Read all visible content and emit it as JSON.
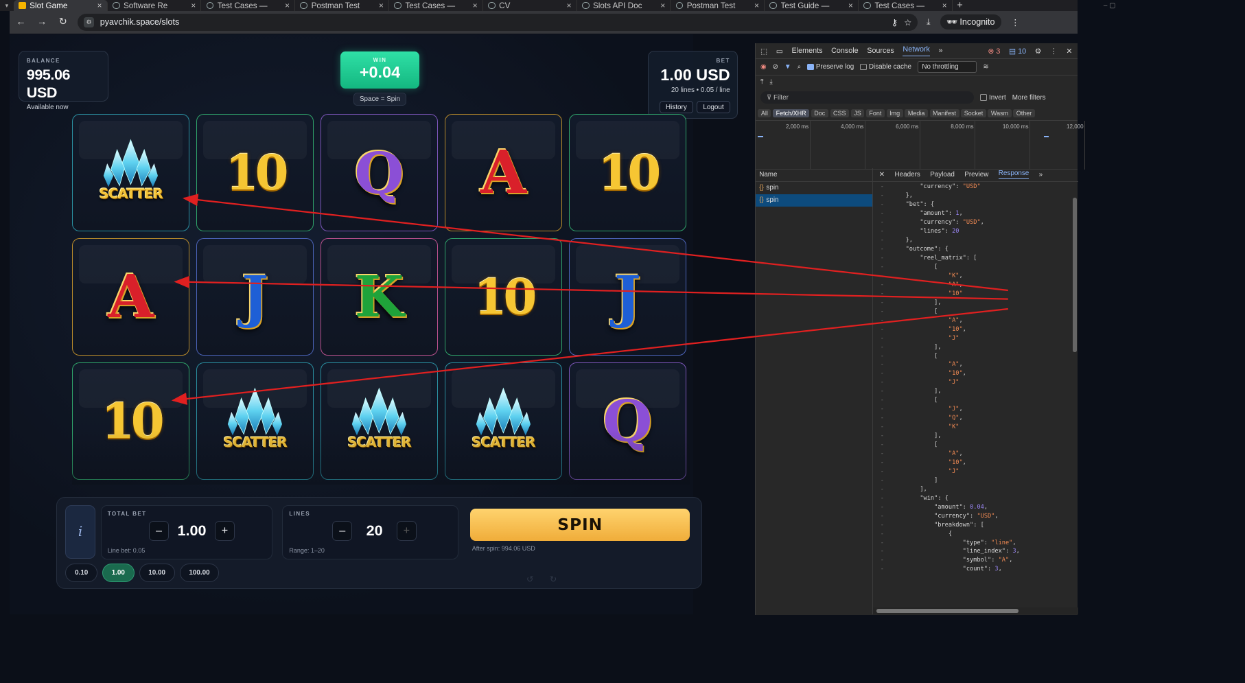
{
  "browser": {
    "tabs": [
      {
        "title": "Slot Game",
        "active": true
      },
      {
        "title": "Software Re"
      },
      {
        "title": "Test Cases —"
      },
      {
        "title": "Postman Test"
      },
      {
        "title": "Test Cases —"
      },
      {
        "title": "CV"
      },
      {
        "title": "Slots API Doc"
      },
      {
        "title": "Postman Test"
      },
      {
        "title": "Test Guide —"
      },
      {
        "title": "Test Cases —"
      }
    ],
    "url": "pyavchik.space/slots",
    "incognito_label": "Incognito"
  },
  "game": {
    "balance": {
      "label": "BALANCE",
      "amount": "995.06 USD",
      "sub": "Available now"
    },
    "win": {
      "label": "WIN",
      "amount": "+0.04"
    },
    "hint": "Space = Spin",
    "bet": {
      "label": "BET",
      "amount": "1.00 USD",
      "sub": "20 lines • 0.05 / line",
      "history": "History",
      "logout": "Logout"
    },
    "reels": [
      [
        "scatter",
        "A",
        "10"
      ],
      [
        "10",
        "J",
        "scatter"
      ],
      [
        "Q",
        "K",
        "scatter"
      ],
      [
        "A",
        "10",
        "scatter"
      ],
      [
        "10",
        "J",
        "Q"
      ]
    ],
    "scatter_text": "SCATTER",
    "controls": {
      "info": "i",
      "total_bet_label": "TOTAL BET",
      "total_bet": "1.00",
      "line_bet": "Line bet: 0.05",
      "lines_label": "LINES",
      "lines": "20",
      "range": "Range: 1–20",
      "spin": "SPIN",
      "after_spin": "After spin: 994.06 USD",
      "chips": [
        "0.10",
        "1.00",
        "10.00",
        "100.00"
      ],
      "selected_chip": "1.00",
      "minus": "–",
      "plus": "+"
    }
  },
  "devtools": {
    "tabs": [
      "Elements",
      "Console",
      "Sources",
      "Network"
    ],
    "active_tab": "Network",
    "errors": "3",
    "messages": "10",
    "preserve_log": "Preserve log",
    "disable_cache": "Disable cache",
    "throttling": "No throttling",
    "filter_placeholder": "Filter",
    "invert": "Invert",
    "more_filters": "More filters",
    "type_filters": [
      "All",
      "Fetch/XHR",
      "Doc",
      "CSS",
      "JS",
      "Font",
      "Img",
      "Media",
      "Manifest",
      "Socket",
      "Wasm",
      "Other"
    ],
    "active_type": "Fetch/XHR",
    "timeline_labels": [
      "2,000 ms",
      "4,000 ms",
      "6,000 ms",
      "8,000 ms",
      "10,000 ms",
      "12,000"
    ],
    "name_header": "Name",
    "requests": [
      "spin",
      "spin"
    ],
    "detail_tabs": [
      "Headers",
      "Payload",
      "Preview",
      "Response"
    ],
    "active_detail": "Response",
    "response_lines": [
      "        \"currency\": \"USD\"",
      "    },",
      "    \"bet\": {",
      "        \"amount\": 1,",
      "        \"currency\": \"USD\",",
      "        \"lines\": 20",
      "    },",
      "    \"outcome\": {",
      "        \"reel_matrix\": [",
      "            [",
      "                \"K\",",
      "                \"A\",",
      "                \"10\"",
      "            ],",
      "            [",
      "                \"A\",",
      "                \"10\",",
      "                \"J\"",
      "            ],",
      "            [",
      "                \"A\",",
      "                \"10\",",
      "                \"J\"",
      "            ],",
      "            [",
      "                \"J\",",
      "                \"Q\",",
      "                \"K\"",
      "            ],",
      "            [",
      "                \"A\",",
      "                \"10\",",
      "                \"J\"",
      "            ]",
      "        ],",
      "        \"win\": {",
      "            \"amount\": 0.04,",
      "            \"currency\": \"USD\",",
      "            \"breakdown\": [",
      "                {",
      "                    \"type\": \"line\",",
      "                    \"line_index\": 3,",
      "                    \"symbol\": \"A\",",
      "                    \"count\": 3,"
    ]
  },
  "colors": {
    "win_green": "#22c993",
    "spin_gold": "#f5bd4f",
    "arrow_red": "#e02020",
    "accent_blue": "#8ab4f8"
  }
}
